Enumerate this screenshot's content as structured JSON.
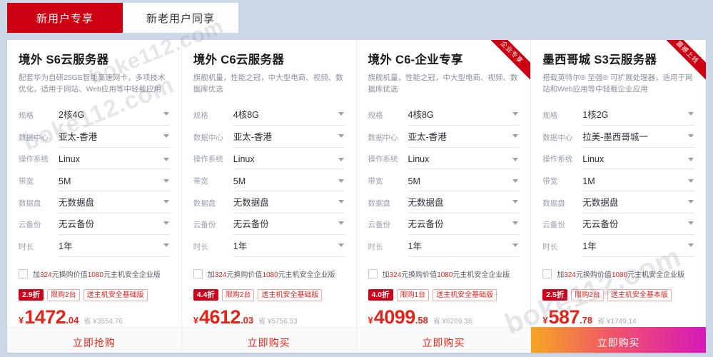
{
  "theme": {
    "page_background": "#ccd8e8",
    "brand_red": "#cc0011",
    "price_red": "#e1251b",
    "card_background": "#ffffff",
    "gradient_button": "#f5a623 -> #d619b8"
  },
  "watermark": {
    "text": "boke112.com"
  },
  "tabs": [
    {
      "label": "新用户专享",
      "active": true
    },
    {
      "label": "新老用户同享",
      "active": false
    }
  ],
  "cards": [
    {
      "title": "境外 S6云服务器",
      "desc": "配套华为自研25GE智能高速网卡，多项技术优化，适用于网站、Web应用等中轻载应用",
      "ribbon": null,
      "specs": [
        {
          "label": "规格",
          "value": "2核4G"
        },
        {
          "label": "数据中心",
          "value": "亚太-香港"
        },
        {
          "label": "操作系统",
          "value": "Linux"
        },
        {
          "label": "带宽",
          "value": "5M"
        },
        {
          "label": "数据盘",
          "value": "无数据盘"
        },
        {
          "label": "云备份",
          "value": "无云备份"
        },
        {
          "label": "时长",
          "value": "1年"
        }
      ],
      "addon": {
        "checked": false,
        "prefix": "加",
        "amount": "324",
        "middle": "元换购价值",
        "value": "1080",
        "suffix": "元主机安全企业版"
      },
      "badges": {
        "discount": "2.9折",
        "limit": "限购2台",
        "gift": "送主机安全基础版"
      },
      "price": {
        "currency": "¥",
        "integer": "1472",
        "decimal": ".04",
        "original": "省 ¥3554.76"
      },
      "button": {
        "label": "立即抢购",
        "style": "plain"
      }
    },
    {
      "title": "境外 C6云服务器",
      "desc": "旗舰机量，性能之冠，中大型电商、视频、数据库优选",
      "ribbon": null,
      "specs": [
        {
          "label": "规格",
          "value": "4核8G"
        },
        {
          "label": "数据中心",
          "value": "亚太-香港"
        },
        {
          "label": "操作系统",
          "value": "Linux"
        },
        {
          "label": "带宽",
          "value": "5M"
        },
        {
          "label": "数据盘",
          "value": "无数据盘"
        },
        {
          "label": "云备份",
          "value": "无云备份"
        },
        {
          "label": "时长",
          "value": "1年"
        }
      ],
      "addon": {
        "checked": false,
        "prefix": "加",
        "amount": "324",
        "middle": "元换购价值",
        "value": "1080",
        "suffix": "元主机安全企业版"
      },
      "badges": {
        "discount": "4.4折",
        "limit": "限购2台",
        "gift": "送主机安全基础版"
      },
      "price": {
        "currency": "¥",
        "integer": "4612",
        "decimal": ".03",
        "original": "省 ¥5756.93"
      },
      "button": {
        "label": "立即购买",
        "style": "plain"
      }
    },
    {
      "title": "境外 C6-企业专享",
      "desc": "旗舰机量，性能之冠，中大型电商、视频、数据库优选",
      "ribbon": "企业专享",
      "specs": [
        {
          "label": "规格",
          "value": "4核8G"
        },
        {
          "label": "数据中心",
          "value": "亚太-香港"
        },
        {
          "label": "操作系统",
          "value": "Linux"
        },
        {
          "label": "带宽",
          "value": "5M"
        },
        {
          "label": "数据盘",
          "value": "无数据盘"
        },
        {
          "label": "云备份",
          "value": "无云备份"
        },
        {
          "label": "时长",
          "value": "1年"
        }
      ],
      "addon": {
        "checked": false,
        "prefix": "加",
        "amount": "324",
        "middle": "元换购价值",
        "value": "1080",
        "suffix": "元主机安全企业版"
      },
      "badges": {
        "discount": "4.0折",
        "limit": "限购1台",
        "gift": "送主机安全基础版"
      },
      "price": {
        "currency": "¥",
        "integer": "4099",
        "decimal": ".58",
        "original": "省 ¥6269.38"
      },
      "button": {
        "label": "立即购买",
        "style": "plain"
      }
    },
    {
      "title": "墨西哥城 S3云服务器",
      "desc": "搭载英特尔® 至强® 可扩展处理器，适用于网站和Web应用等中轻载企业应用",
      "ribbon": "震撼上线",
      "specs": [
        {
          "label": "规格",
          "value": "1核2G"
        },
        {
          "label": "数据中心",
          "value": "拉美-墨西哥城一"
        },
        {
          "label": "操作系统",
          "value": "Linux"
        },
        {
          "label": "带宽",
          "value": "1M"
        },
        {
          "label": "数据盘",
          "value": "无数据盘"
        },
        {
          "label": "云备份",
          "value": "无云备份"
        },
        {
          "label": "时长",
          "value": "1年"
        }
      ],
      "addon": {
        "checked": false,
        "prefix": "加",
        "amount": "324",
        "middle": "元换购价值",
        "value": "1080",
        "suffix": "元主机安全企业版"
      },
      "badges": {
        "discount": "2.5折",
        "limit": "限购2台",
        "gift": "送主机安全基本版"
      },
      "price": {
        "currency": "¥",
        "integer": "587",
        "decimal": ".78",
        "original": "省 ¥1749.14"
      },
      "button": {
        "label": "立即购买",
        "style": "gradient"
      }
    }
  ]
}
